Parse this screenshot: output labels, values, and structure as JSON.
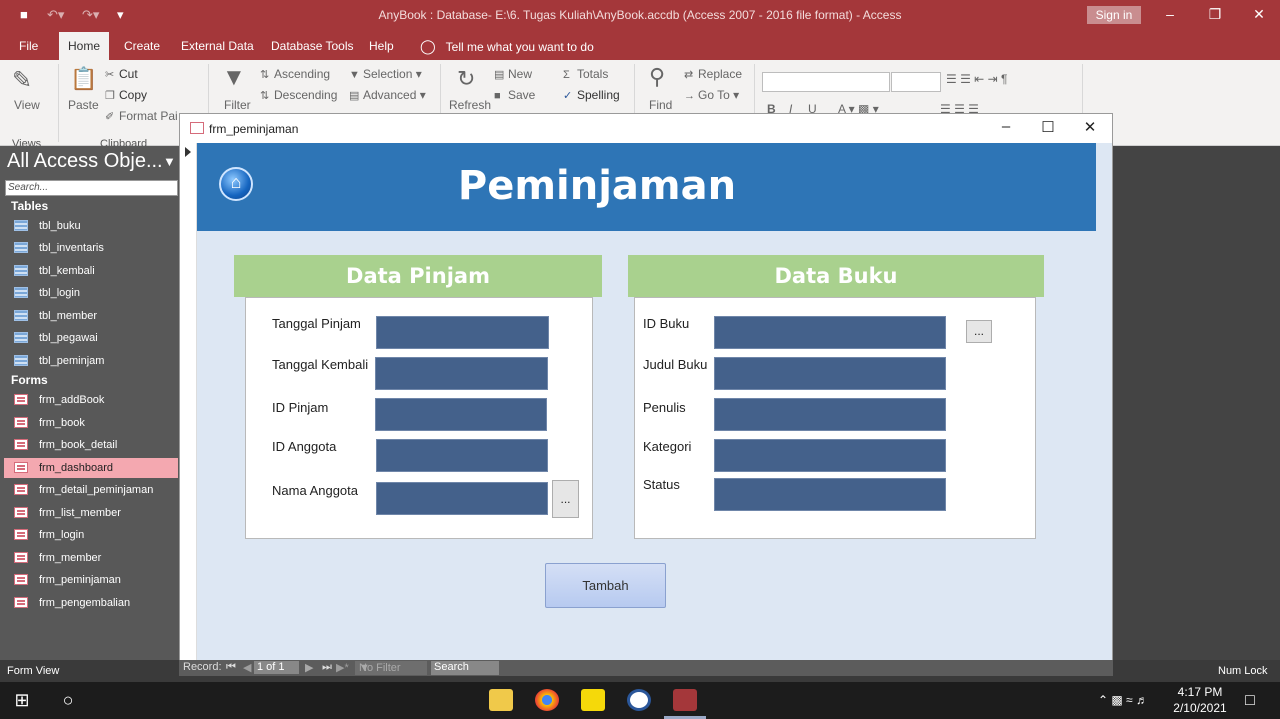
{
  "app": {
    "title": "AnyBook : Database- E:\\6. Tugas Kuliah\\AnyBook.accdb (Access 2007 - 2016 file format)  -  Access",
    "sign_in": "Sign in"
  },
  "menu": {
    "tabs": [
      "File",
      "Home",
      "Create",
      "External Data",
      "Database Tools",
      "Help"
    ],
    "tell_me": "Tell me what you want to do"
  },
  "ribbon": {
    "view": "View",
    "paste": "Paste",
    "cut": "Cut",
    "copy": "Copy",
    "format_painter": "Format Pai",
    "filter": "Filter",
    "ascending": "Ascending",
    "descending": "Descending",
    "selection": "Selection ▾",
    "advanced": "Advanced ▾",
    "refresh": "Refresh",
    "new": "New",
    "save": "Save",
    "totals": "Totals",
    "spelling": "Spelling",
    "find": "Find",
    "replace": "Replace",
    "go_to": "Go To ▾",
    "group_views": "Views",
    "group_clipboard": "Clipboard",
    "font_b": "B",
    "font_i": "I",
    "font_u": "U"
  },
  "nav": {
    "header": "All Access Obje...",
    "search_placeholder": "Search...",
    "tables_label": "Tables",
    "tables": [
      "tbl_buku",
      "tbl_inventaris",
      "tbl_kembali",
      "tbl_login",
      "tbl_member",
      "tbl_pegawai",
      "tbl_peminjam"
    ],
    "forms_label": "Forms",
    "forms": [
      "frm_addBook",
      "frm_book",
      "frm_book_detail",
      "frm_dashboard",
      "frm_detail_peminjaman",
      "frm_list_member",
      "frm_login",
      "frm_member",
      "frm_peminjaman",
      "frm_pengembalian"
    ],
    "selected_form": "frm_dashboard"
  },
  "form": {
    "window_title": "frm_peminjaman",
    "header_title": "Peminjaman",
    "section_pinjam": "Data Pinjam",
    "section_buku": "Data Buku",
    "pinjam_fields": [
      "Tanggal Pinjam",
      "Tanggal Kembali",
      "ID Pinjam",
      "ID Anggota",
      "Nama Anggota"
    ],
    "buku_fields": [
      "ID Buku",
      "Judul Buku",
      "Penulis",
      "Kategori",
      "Status"
    ],
    "lookup_button": "...",
    "submit_button": "Tambah"
  },
  "record_nav": {
    "label": "Record:",
    "position": "1 of 1",
    "filter": "No Filter",
    "search": "Search"
  },
  "status": {
    "left": "Form View",
    "right": "Num Lock"
  },
  "taskbar": {
    "time": "4:17 PM",
    "date": "2/10/2021"
  },
  "colors": {
    "title_bar": "#a4373a",
    "form_header": "#2e75b6",
    "section_header": "#a9d18e",
    "field_bg": "#44618b",
    "form_canvas": "#dde7f3",
    "nav_selected": "#f4a8b0"
  }
}
